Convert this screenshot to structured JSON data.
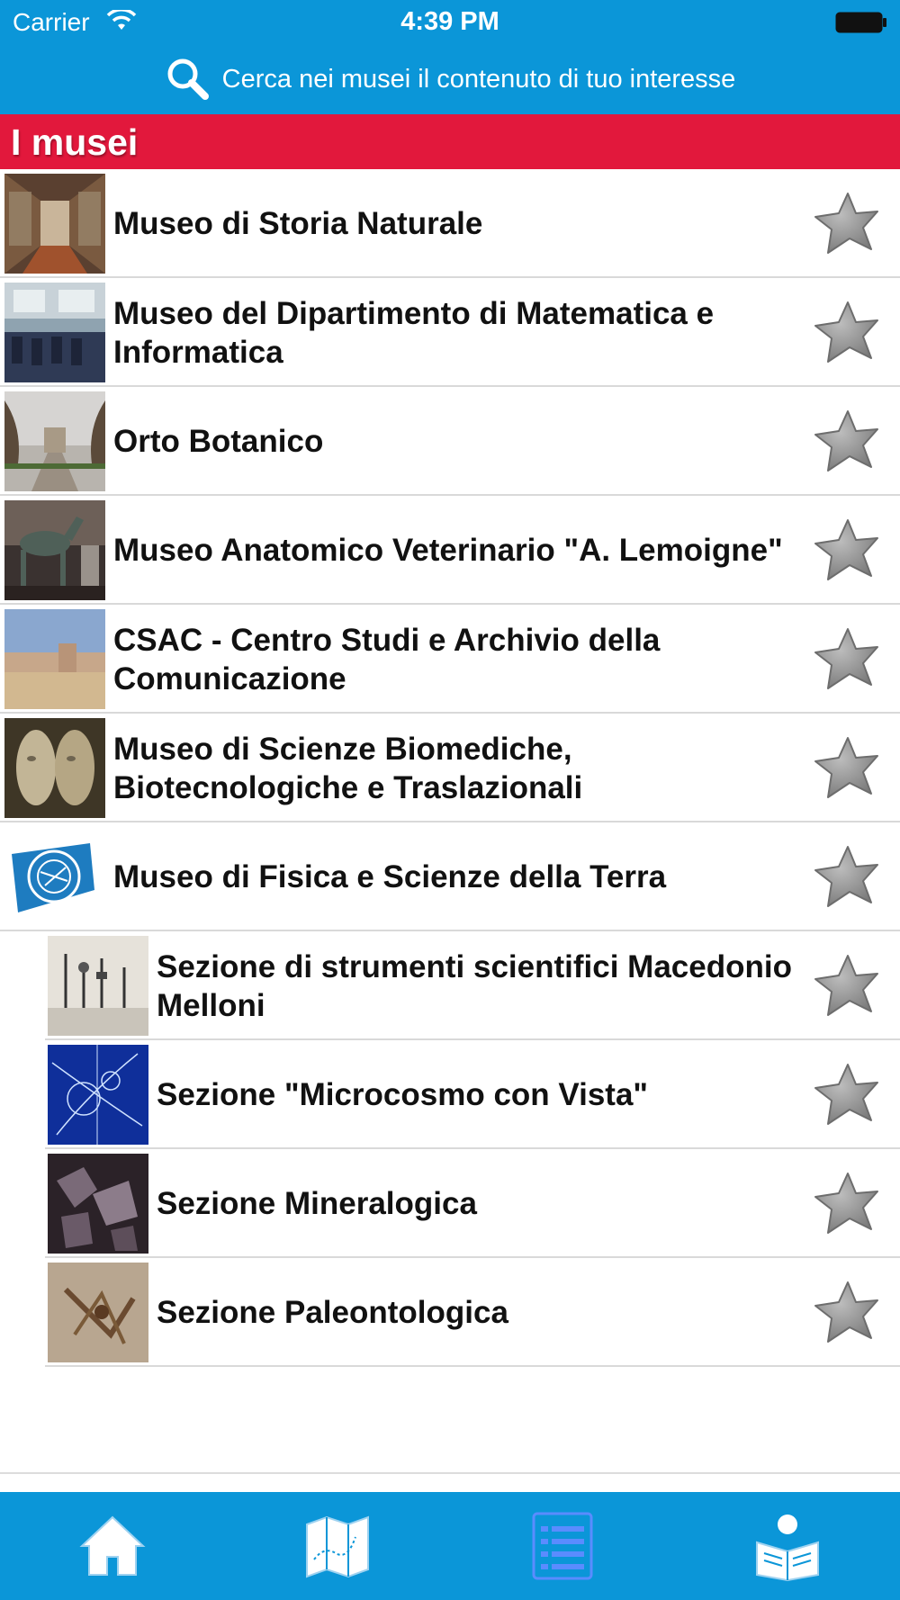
{
  "status_bar": {
    "carrier": "Carrier",
    "time": "4:39 PM"
  },
  "search": {
    "label": "Cerca nei musei il contenuto di tuo interesse"
  },
  "section": {
    "title": "I musei"
  },
  "museums": [
    {
      "name": "Museo di Storia Naturale",
      "thumbnail": "gallery-hall"
    },
    {
      "name": "Museo del Dipartimento di Matematica e Informatica",
      "thumbnail": "classroom"
    },
    {
      "name": "Orto Botanico",
      "thumbnail": "garden-path"
    },
    {
      "name": "Museo Anatomico Veterinario \"A. Lemoigne\"",
      "thumbnail": "horse-skeleton"
    },
    {
      "name": "CSAC - Centro Studi e Archivio della Comunicazione",
      "thumbnail": "abbey-field"
    },
    {
      "name": "Museo di Scienze Biomediche, Biotecnologiche e Traslazionali",
      "thumbnail": "anatomical-faces"
    },
    {
      "name": "Museo di Fisica e Scienze della Terra",
      "thumbnail": "blue-logo"
    },
    {
      "name": "Sezione di strumenti scientifici Macedonio Melloni",
      "thumbnail": "instruments"
    },
    {
      "name": "Sezione \"Microcosmo con Vista\"",
      "thumbnail": "particle-tracks"
    },
    {
      "name": "Sezione Mineralogica",
      "thumbnail": "minerals"
    },
    {
      "name": "Sezione Paleontologica",
      "thumbnail": "fossil"
    }
  ],
  "tabs": [
    {
      "id": "home",
      "icon": "home-icon"
    },
    {
      "id": "map",
      "icon": "map-icon"
    },
    {
      "id": "list",
      "icon": "list-icon",
      "selected": true
    },
    {
      "id": "news",
      "icon": "news-reader-icon"
    }
  ],
  "colors": {
    "header": "#0b96d8",
    "section": "#e2183c",
    "selected_tab": "#5a8cff"
  }
}
